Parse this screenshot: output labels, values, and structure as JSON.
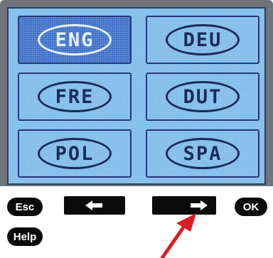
{
  "screen": {
    "languages": [
      {
        "code": "ENG",
        "selected": true
      },
      {
        "code": "DEU",
        "selected": false
      },
      {
        "code": "FRE",
        "selected": false
      },
      {
        "code": "DUT",
        "selected": false
      },
      {
        "code": "POL",
        "selected": false
      },
      {
        "code": "SPA",
        "selected": false
      }
    ]
  },
  "controls": {
    "esc_label": "Esc",
    "help_label": "Help",
    "ok_label": "OK",
    "left_icon": "arrow-left-icon",
    "right_icon": "arrow-right-icon"
  },
  "annotation": {
    "arrow_color": "#d81f26"
  },
  "colors": {
    "lcd_background": "#7fbcea",
    "selected_tile": "#3e71c8",
    "tile_border": "#26387a",
    "button_background": "#0b0b0b"
  }
}
